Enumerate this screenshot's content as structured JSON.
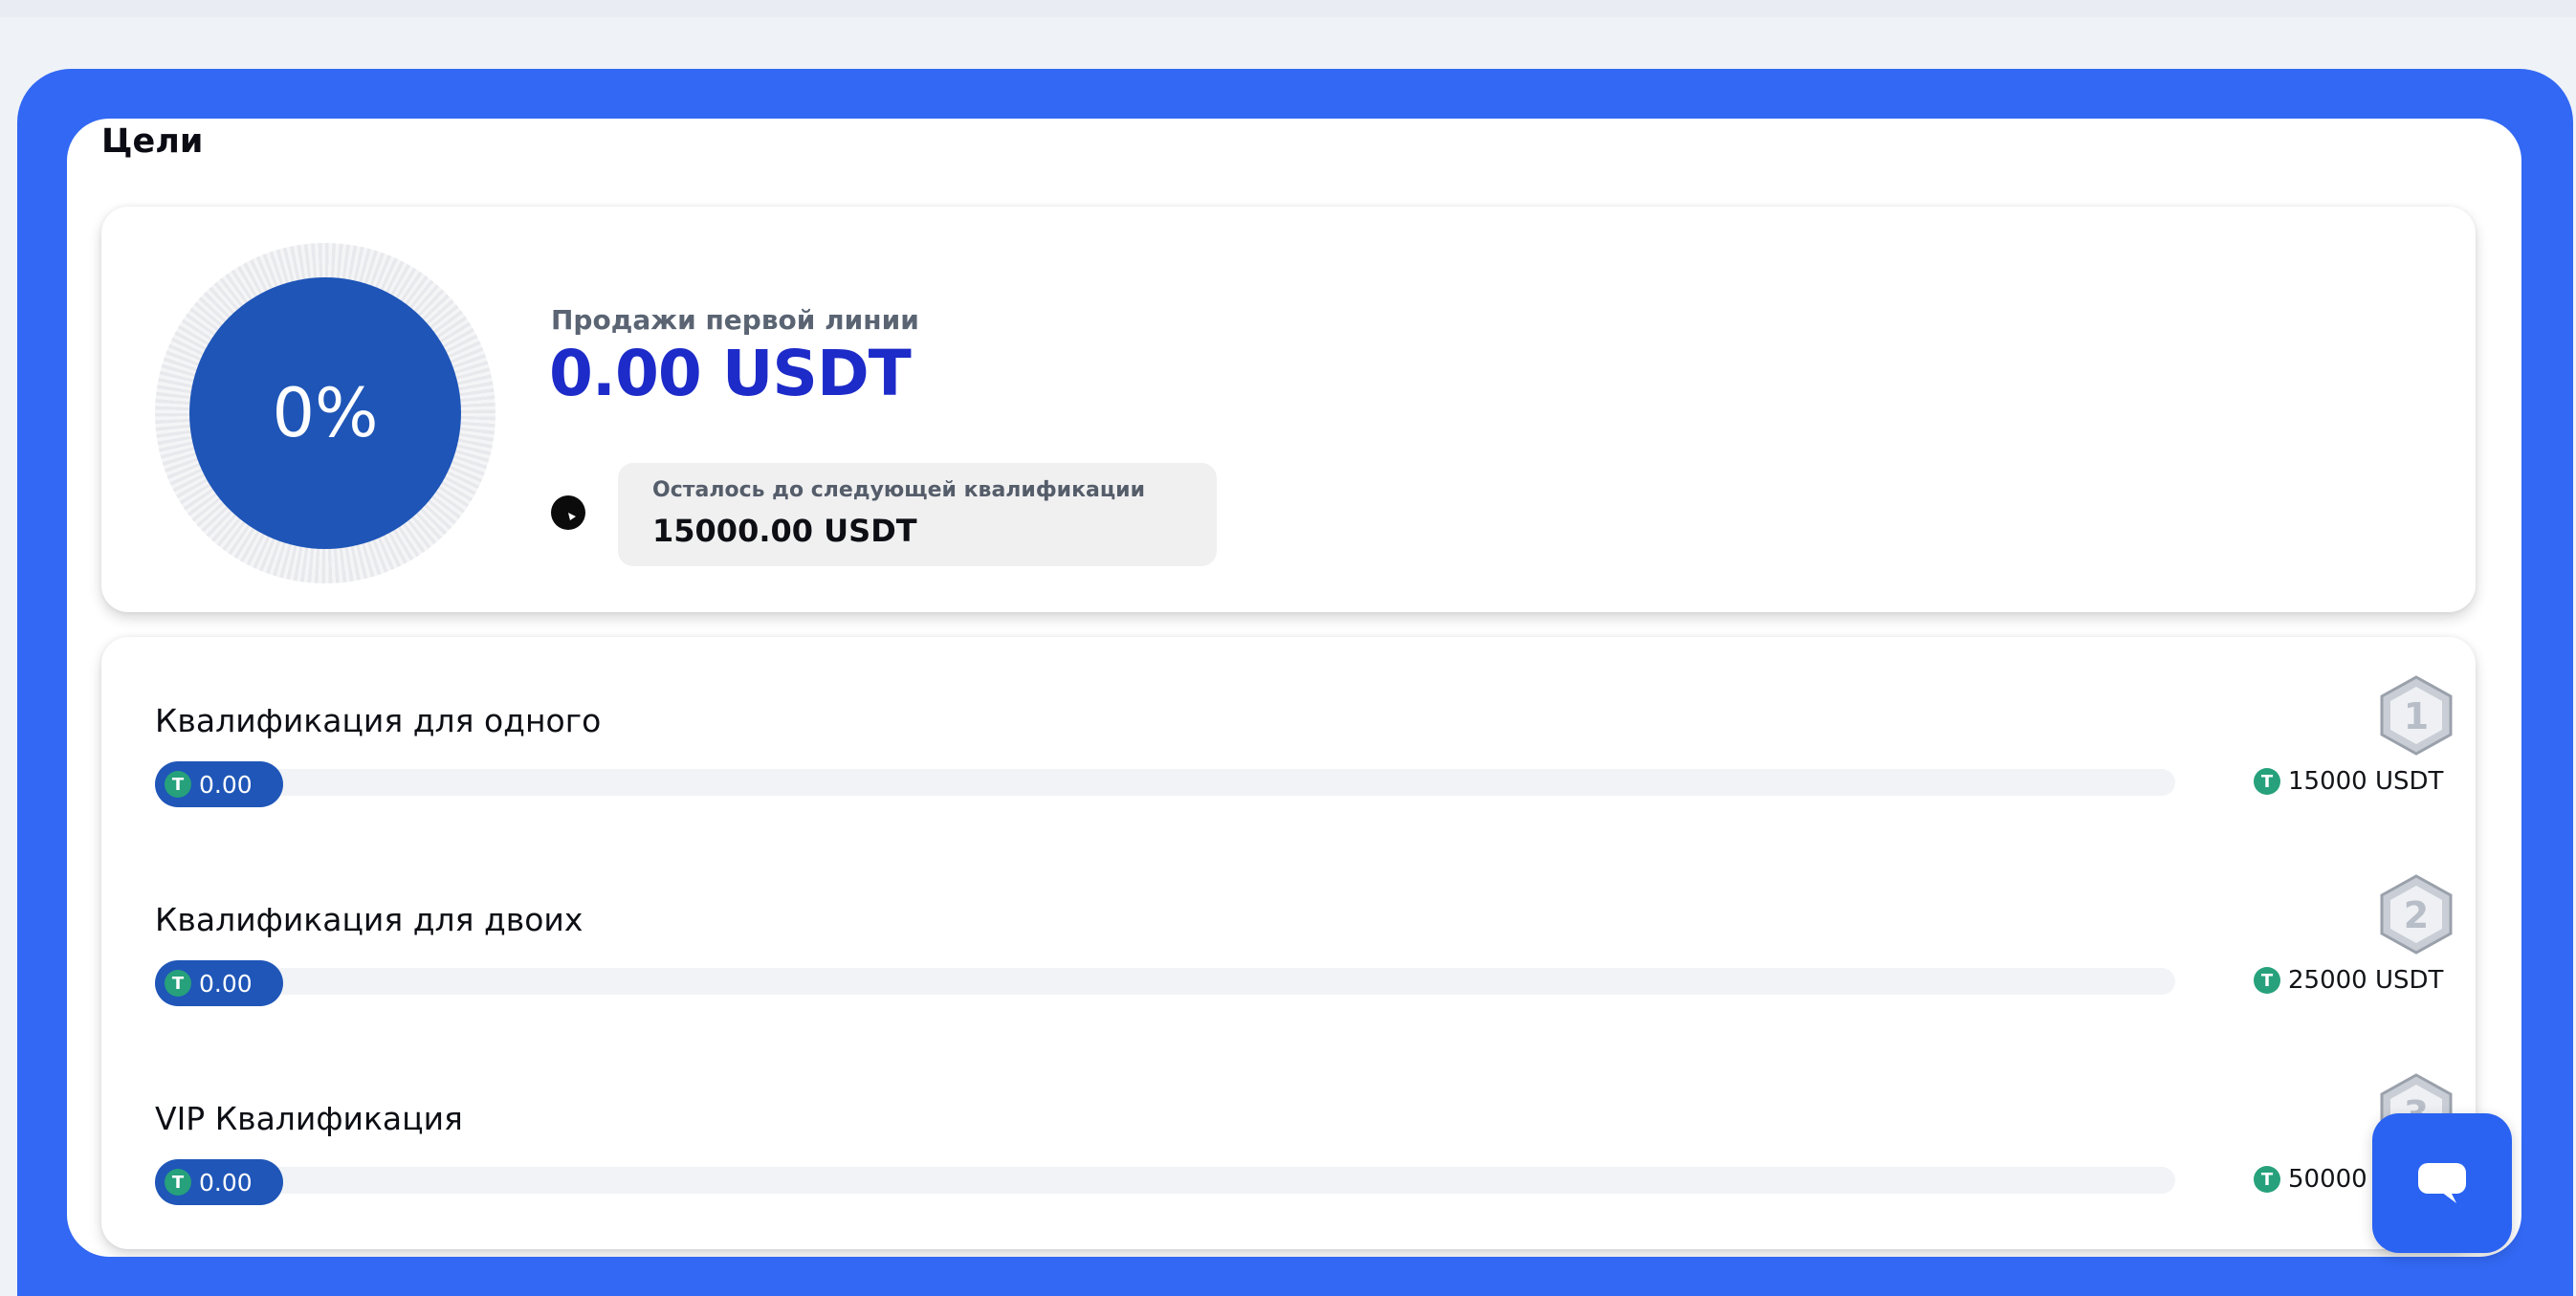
{
  "section_title": "Цели",
  "sales": {
    "progress_percent": "0%",
    "label": "Продажи первой линии",
    "value": "0.00 USDT"
  },
  "next_qualification": {
    "label": "Осталось до следующей квалификации",
    "value": "15000.00 USDT"
  },
  "qualifications": [
    {
      "title": "Квалификация для одного",
      "current": "0.00",
      "target": "15000 USDT",
      "badge_number": "1",
      "progress": 0
    },
    {
      "title": "Квалификация для двоих",
      "current": "0.00",
      "target": "25000 USDT",
      "badge_number": "2",
      "progress": 0
    },
    {
      "title": "VIP Квалификация",
      "current": "0.00",
      "target": "50000",
      "badge_number": "3",
      "progress": 0
    }
  ],
  "coin_glyph": "T",
  "colors": {
    "frame_blue": "#3268f3",
    "progress_blue": "#1e55b7",
    "value_blue": "#1d2bc9",
    "tether_green": "#26a17b"
  }
}
